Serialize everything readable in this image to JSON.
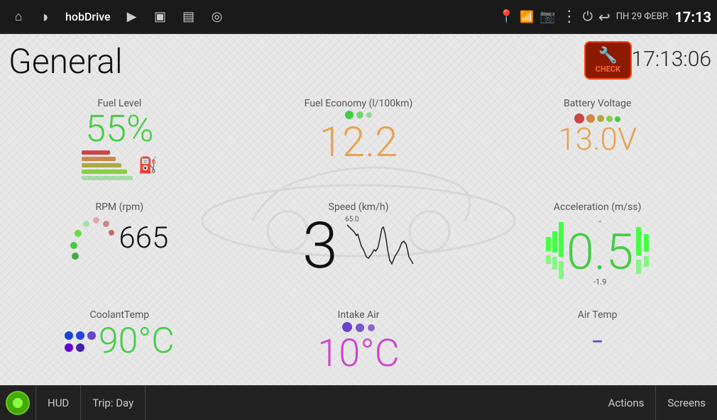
{
  "statusBar": {
    "appTitle": "hobDrive",
    "date": "ПН 29 ФЕВР.",
    "time": "17:13",
    "icons": {
      "home": "⌂",
      "history": "◑",
      "play": "▶",
      "image": "▣",
      "screen": "▤",
      "steering": "◎",
      "location": "⚲",
      "wifi": "📶",
      "camera": "📷",
      "menu": "⋮",
      "power": "⏻",
      "back": "↩"
    }
  },
  "main": {
    "pageTitle": "General",
    "checkEngine": {
      "line1": "CHECK",
      "badge": "🔧"
    },
    "timeDisplay": "17:13:06"
  },
  "sensors": {
    "fuelLevel": {
      "label": "Fuel Level",
      "value": "55%",
      "numericValue": 55
    },
    "fuelEconomy": {
      "label": "Fuel Economy (l/100km)",
      "value": "12.2"
    },
    "batteryVoltage": {
      "label": "Battery Voltage",
      "value": "13.0V"
    },
    "rpm": {
      "label": "RPM (rpm)",
      "value": "665"
    },
    "speed": {
      "label": "Speed (km/h)",
      "value": "3",
      "chartMax": "65.0"
    },
    "acceleration": {
      "label": "Acceleration (m/ss)",
      "value": "0.5",
      "minValue": "-1.9"
    },
    "coolantTemp": {
      "label": "CoolantTemp",
      "value": "90°C"
    },
    "intakeAir": {
      "label": "Intake Air",
      "value": "10°C"
    },
    "airTemp": {
      "label": "Air Temp",
      "value": "-"
    }
  },
  "toolbar": {
    "hudLabel": "HUD",
    "tripLabel": "Trip: Day",
    "actionsLabel": "Actions",
    "screensLabel": "Screens"
  }
}
